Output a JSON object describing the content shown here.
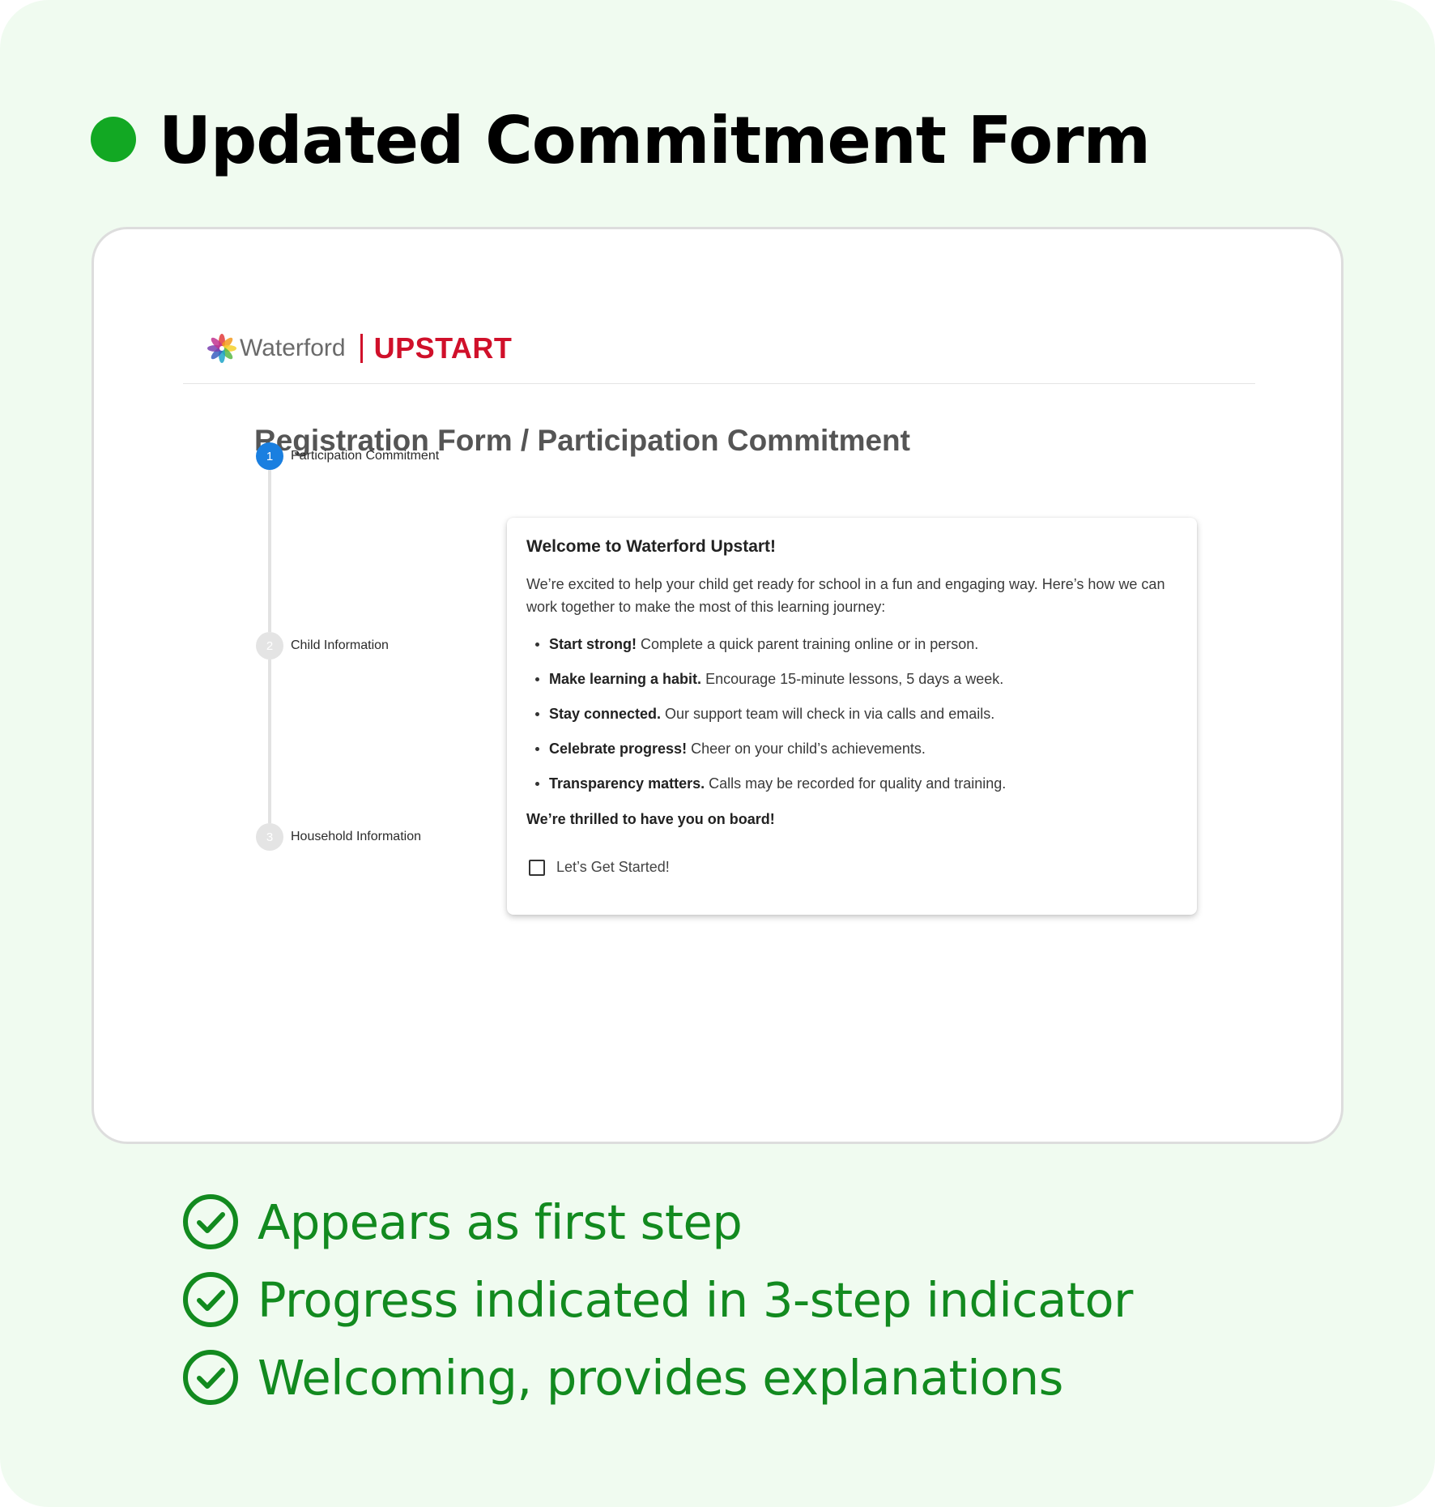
{
  "heading": {
    "title": "Updated Commitment Form",
    "dot_color": "#12a823"
  },
  "app": {
    "brand_name": "Waterford",
    "brand_product": "UPSTART",
    "brand_color": "#d0102a",
    "page_title": "Registration Form / Participation Commitment"
  },
  "stepper": {
    "active_step": 1,
    "active_color": "#1a7fe0",
    "steps": [
      {
        "number": "1",
        "label": "Participation Commitment",
        "state": "active"
      },
      {
        "number": "2",
        "label": "Child Information",
        "state": "inactive"
      },
      {
        "number": "3",
        "label": "Household Information",
        "state": "inactive"
      }
    ]
  },
  "panel": {
    "title": "Welcome to Waterford Upstart!",
    "intro": "We’re excited to help your child get ready for school in a fun and engaging way. Here’s how we can work together to make the most of this learning journey:",
    "items": [
      {
        "strong": "Start strong!",
        "text": " Complete a quick parent training online or in person."
      },
      {
        "strong": "Make learning a habit.",
        "text": " Encourage 15-minute lessons, 5 days a week."
      },
      {
        "strong": "Stay connected.",
        "text": " Our support team will check in via calls and emails."
      },
      {
        "strong": "Celebrate progress!",
        "text": " Cheer on your child’s achievements."
      },
      {
        "strong": "Transparency matters.",
        "text": " Calls may be recorded for quality and training."
      }
    ],
    "closing": "We’re thrilled to have you on board!",
    "checkbox_label": "Let’s Get Started!",
    "checkbox_checked": false
  },
  "benefits": {
    "color": "#128a1f",
    "icon": "check-circle-icon",
    "items": [
      "Appears as first step",
      "Progress indicated in 3-step indicator",
      "Welcoming, provides explanations"
    ]
  }
}
